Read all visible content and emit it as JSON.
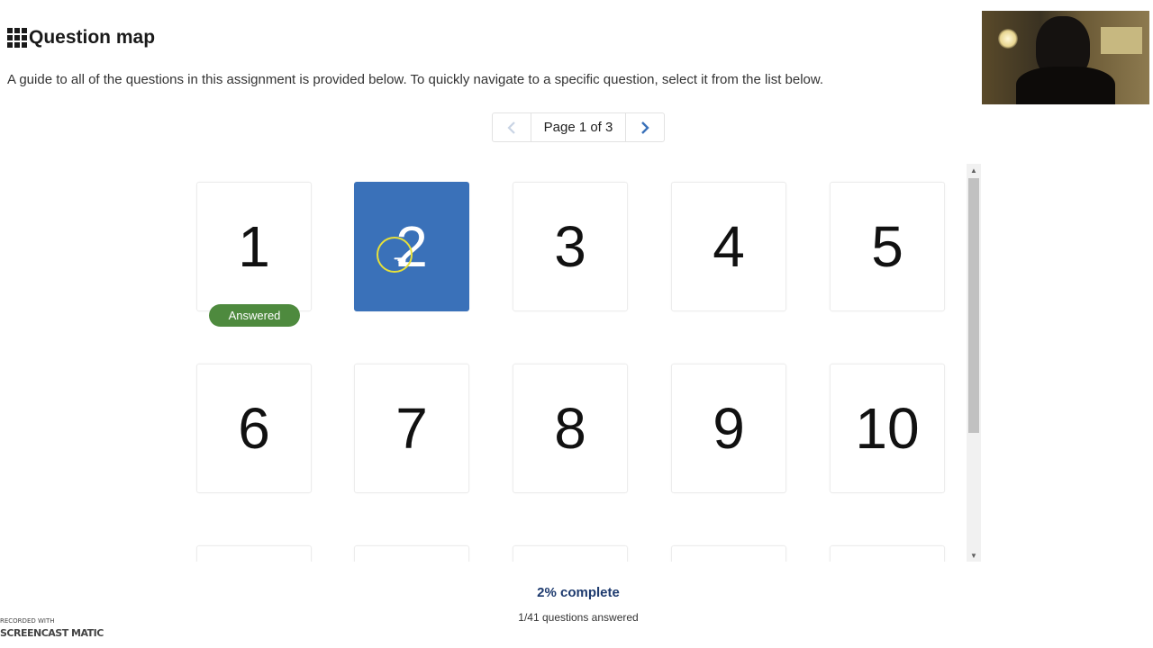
{
  "header": {
    "title": "Question map",
    "description": "A guide to all of the questions in this assignment is provided below. To quickly navigate to a specific question, select it from the list below."
  },
  "pager": {
    "label": "Page 1 of 3",
    "prev_icon": "chevron-left-icon",
    "next_icon": "chevron-right-icon"
  },
  "questions": [
    {
      "number": "1",
      "status": "Answered"
    },
    {
      "number": "2",
      "selected": true
    },
    {
      "number": "3"
    },
    {
      "number": "4"
    },
    {
      "number": "5"
    },
    {
      "number": "6"
    },
    {
      "number": "7"
    },
    {
      "number": "8"
    },
    {
      "number": "9"
    },
    {
      "number": "10"
    }
  ],
  "progress": {
    "percent_text": "2% complete",
    "answered_text": "1/41 questions answered",
    "percent": 2
  },
  "watermark": {
    "line1": "RECORDED WITH",
    "line2": "SCREENCAST MATIC"
  },
  "colors": {
    "selected": "#3a71b9",
    "answered_badge": "#4e8a3e",
    "progress_text": "#1d3a6e",
    "pager_chevron": "#3a71b9"
  }
}
